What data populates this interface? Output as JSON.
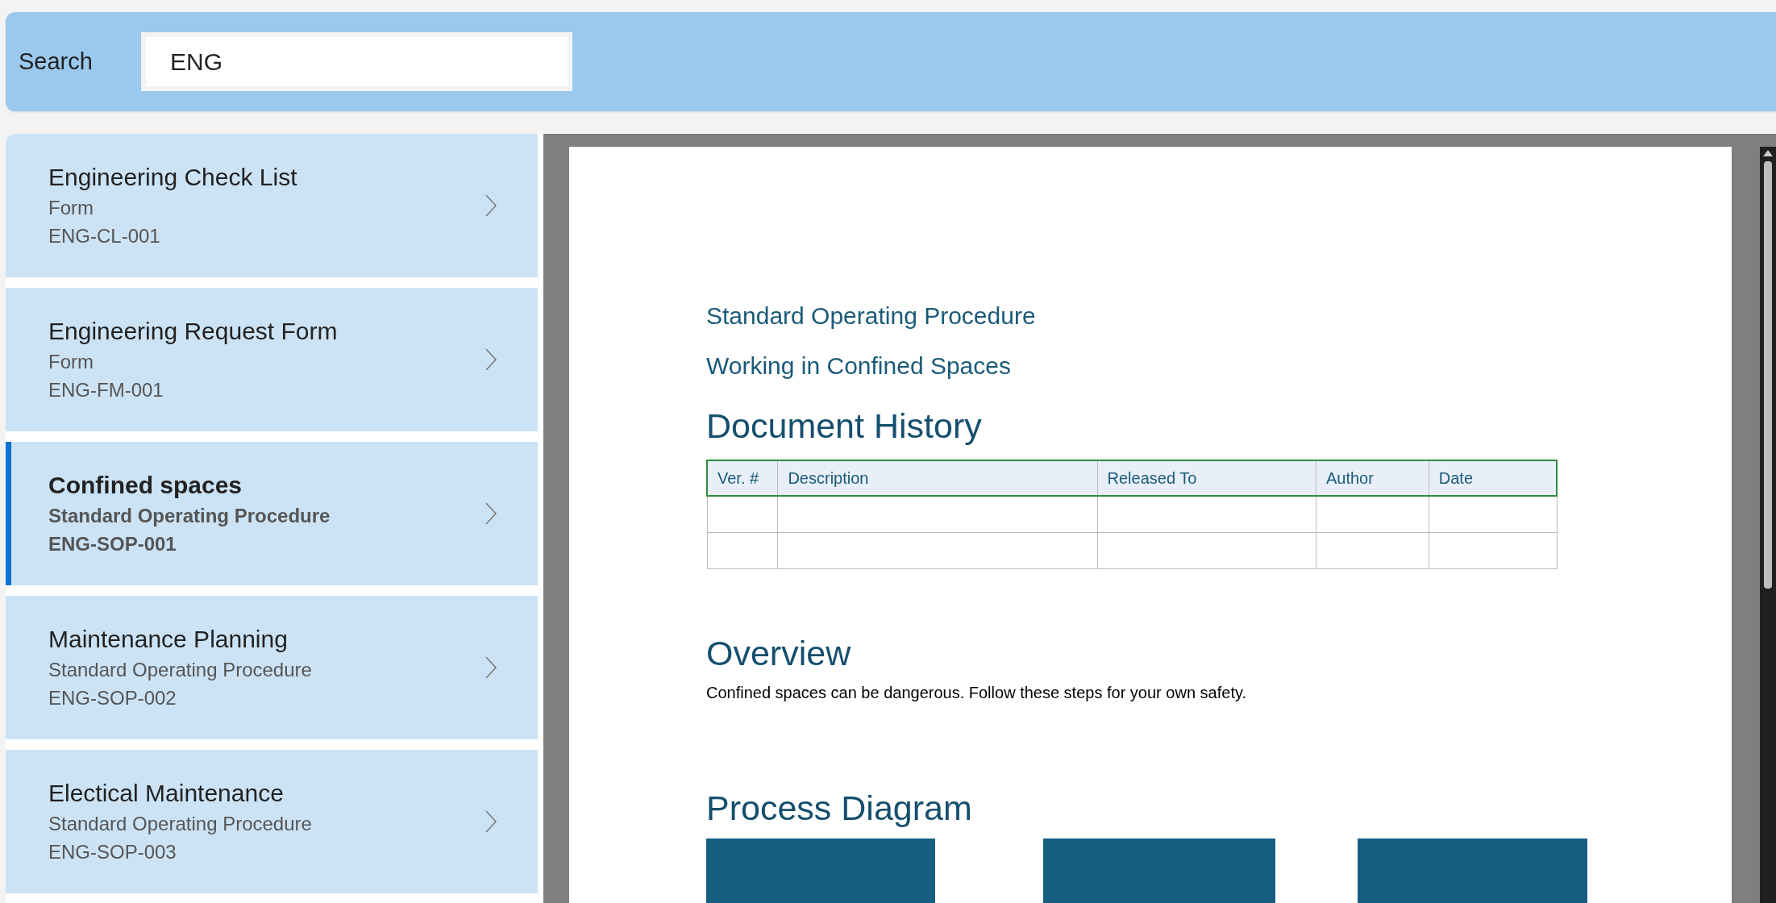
{
  "search": {
    "label": "Search",
    "value": "ENG"
  },
  "documents": [
    {
      "title": "Engineering Check List",
      "type": "Form",
      "code": "ENG-CL-001",
      "selected": false
    },
    {
      "title": "Engineering Request Form",
      "type": "Form",
      "code": "ENG-FM-001",
      "selected": false
    },
    {
      "title": "Confined spaces",
      "type": "Standard Operating Procedure",
      "code": "ENG-SOP-001",
      "selected": true
    },
    {
      "title": "Maintenance Planning",
      "type": "Standard Operating Procedure",
      "code": "ENG-SOP-002",
      "selected": false
    },
    {
      "title": "Electical Maintenance",
      "type": "Standard Operating Procedure",
      "code": "ENG-SOP-003",
      "selected": false
    }
  ],
  "viewer": {
    "doc_type": "Standard Operating Procedure",
    "doc_title": "Working in Confined Spaces",
    "history": {
      "heading": "Document History",
      "columns": [
        "Ver. #",
        "Description",
        "Released To",
        "Author",
        "Date"
      ]
    },
    "overview": {
      "heading": "Overview",
      "text": "Confined spaces can be dangerous. Follow these steps for your own safety."
    },
    "diagram": {
      "heading": "Process Diagram"
    }
  }
}
